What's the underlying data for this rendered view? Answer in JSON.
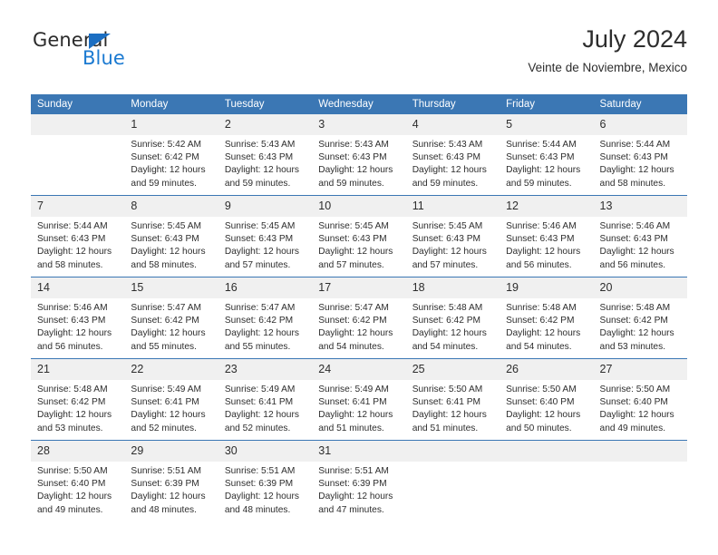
{
  "logo": {
    "word_one": "General",
    "word_two": "Blue",
    "triangle_icon": "triangle-icon"
  },
  "header": {
    "title": "July 2024",
    "subtitle": "Veinte de Noviembre, Mexico"
  },
  "colors": {
    "header_blue": "#3b77b4",
    "logo_blue": "#1b7ad1",
    "daynum_band": "#f0f0f0",
    "text": "#2d2d2d"
  },
  "weekdays": [
    "Sunday",
    "Monday",
    "Tuesday",
    "Wednesday",
    "Thursday",
    "Friday",
    "Saturday"
  ],
  "labels": {
    "sunrise_prefix": "Sunrise:",
    "sunset_prefix": "Sunset:",
    "daylight_prefix": "Daylight:"
  },
  "weeks": [
    [
      {
        "day": "",
        "sunrise": "",
        "sunset": "",
        "daylight_line1": "",
        "daylight_line2": ""
      },
      {
        "day": "1",
        "sunrise": "Sunrise: 5:42 AM",
        "sunset": "Sunset: 6:42 PM",
        "daylight_line1": "Daylight: 12 hours",
        "daylight_line2": "and 59 minutes."
      },
      {
        "day": "2",
        "sunrise": "Sunrise: 5:43 AM",
        "sunset": "Sunset: 6:43 PM",
        "daylight_line1": "Daylight: 12 hours",
        "daylight_line2": "and 59 minutes."
      },
      {
        "day": "3",
        "sunrise": "Sunrise: 5:43 AM",
        "sunset": "Sunset: 6:43 PM",
        "daylight_line1": "Daylight: 12 hours",
        "daylight_line2": "and 59 minutes."
      },
      {
        "day": "4",
        "sunrise": "Sunrise: 5:43 AM",
        "sunset": "Sunset: 6:43 PM",
        "daylight_line1": "Daylight: 12 hours",
        "daylight_line2": "and 59 minutes."
      },
      {
        "day": "5",
        "sunrise": "Sunrise: 5:44 AM",
        "sunset": "Sunset: 6:43 PM",
        "daylight_line1": "Daylight: 12 hours",
        "daylight_line2": "and 59 minutes."
      },
      {
        "day": "6",
        "sunrise": "Sunrise: 5:44 AM",
        "sunset": "Sunset: 6:43 PM",
        "daylight_line1": "Daylight: 12 hours",
        "daylight_line2": "and 58 minutes."
      }
    ],
    [
      {
        "day": "7",
        "sunrise": "Sunrise: 5:44 AM",
        "sunset": "Sunset: 6:43 PM",
        "daylight_line1": "Daylight: 12 hours",
        "daylight_line2": "and 58 minutes."
      },
      {
        "day": "8",
        "sunrise": "Sunrise: 5:45 AM",
        "sunset": "Sunset: 6:43 PM",
        "daylight_line1": "Daylight: 12 hours",
        "daylight_line2": "and 58 minutes."
      },
      {
        "day": "9",
        "sunrise": "Sunrise: 5:45 AM",
        "sunset": "Sunset: 6:43 PM",
        "daylight_line1": "Daylight: 12 hours",
        "daylight_line2": "and 57 minutes."
      },
      {
        "day": "10",
        "sunrise": "Sunrise: 5:45 AM",
        "sunset": "Sunset: 6:43 PM",
        "daylight_line1": "Daylight: 12 hours",
        "daylight_line2": "and 57 minutes."
      },
      {
        "day": "11",
        "sunrise": "Sunrise: 5:45 AM",
        "sunset": "Sunset: 6:43 PM",
        "daylight_line1": "Daylight: 12 hours",
        "daylight_line2": "and 57 minutes."
      },
      {
        "day": "12",
        "sunrise": "Sunrise: 5:46 AM",
        "sunset": "Sunset: 6:43 PM",
        "daylight_line1": "Daylight: 12 hours",
        "daylight_line2": "and 56 minutes."
      },
      {
        "day": "13",
        "sunrise": "Sunrise: 5:46 AM",
        "sunset": "Sunset: 6:43 PM",
        "daylight_line1": "Daylight: 12 hours",
        "daylight_line2": "and 56 minutes."
      }
    ],
    [
      {
        "day": "14",
        "sunrise": "Sunrise: 5:46 AM",
        "sunset": "Sunset: 6:43 PM",
        "daylight_line1": "Daylight: 12 hours",
        "daylight_line2": "and 56 minutes."
      },
      {
        "day": "15",
        "sunrise": "Sunrise: 5:47 AM",
        "sunset": "Sunset: 6:42 PM",
        "daylight_line1": "Daylight: 12 hours",
        "daylight_line2": "and 55 minutes."
      },
      {
        "day": "16",
        "sunrise": "Sunrise: 5:47 AM",
        "sunset": "Sunset: 6:42 PM",
        "daylight_line1": "Daylight: 12 hours",
        "daylight_line2": "and 55 minutes."
      },
      {
        "day": "17",
        "sunrise": "Sunrise: 5:47 AM",
        "sunset": "Sunset: 6:42 PM",
        "daylight_line1": "Daylight: 12 hours",
        "daylight_line2": "and 54 minutes."
      },
      {
        "day": "18",
        "sunrise": "Sunrise: 5:48 AM",
        "sunset": "Sunset: 6:42 PM",
        "daylight_line1": "Daylight: 12 hours",
        "daylight_line2": "and 54 minutes."
      },
      {
        "day": "19",
        "sunrise": "Sunrise: 5:48 AM",
        "sunset": "Sunset: 6:42 PM",
        "daylight_line1": "Daylight: 12 hours",
        "daylight_line2": "and 54 minutes."
      },
      {
        "day": "20",
        "sunrise": "Sunrise: 5:48 AM",
        "sunset": "Sunset: 6:42 PM",
        "daylight_line1": "Daylight: 12 hours",
        "daylight_line2": "and 53 minutes."
      }
    ],
    [
      {
        "day": "21",
        "sunrise": "Sunrise: 5:48 AM",
        "sunset": "Sunset: 6:42 PM",
        "daylight_line1": "Daylight: 12 hours",
        "daylight_line2": "and 53 minutes."
      },
      {
        "day": "22",
        "sunrise": "Sunrise: 5:49 AM",
        "sunset": "Sunset: 6:41 PM",
        "daylight_line1": "Daylight: 12 hours",
        "daylight_line2": "and 52 minutes."
      },
      {
        "day": "23",
        "sunrise": "Sunrise: 5:49 AM",
        "sunset": "Sunset: 6:41 PM",
        "daylight_line1": "Daylight: 12 hours",
        "daylight_line2": "and 52 minutes."
      },
      {
        "day": "24",
        "sunrise": "Sunrise: 5:49 AM",
        "sunset": "Sunset: 6:41 PM",
        "daylight_line1": "Daylight: 12 hours",
        "daylight_line2": "and 51 minutes."
      },
      {
        "day": "25",
        "sunrise": "Sunrise: 5:50 AM",
        "sunset": "Sunset: 6:41 PM",
        "daylight_line1": "Daylight: 12 hours",
        "daylight_line2": "and 51 minutes."
      },
      {
        "day": "26",
        "sunrise": "Sunrise: 5:50 AM",
        "sunset": "Sunset: 6:40 PM",
        "daylight_line1": "Daylight: 12 hours",
        "daylight_line2": "and 50 minutes."
      },
      {
        "day": "27",
        "sunrise": "Sunrise: 5:50 AM",
        "sunset": "Sunset: 6:40 PM",
        "daylight_line1": "Daylight: 12 hours",
        "daylight_line2": "and 49 minutes."
      }
    ],
    [
      {
        "day": "28",
        "sunrise": "Sunrise: 5:50 AM",
        "sunset": "Sunset: 6:40 PM",
        "daylight_line1": "Daylight: 12 hours",
        "daylight_line2": "and 49 minutes."
      },
      {
        "day": "29",
        "sunrise": "Sunrise: 5:51 AM",
        "sunset": "Sunset: 6:39 PM",
        "daylight_line1": "Daylight: 12 hours",
        "daylight_line2": "and 48 minutes."
      },
      {
        "day": "30",
        "sunrise": "Sunrise: 5:51 AM",
        "sunset": "Sunset: 6:39 PM",
        "daylight_line1": "Daylight: 12 hours",
        "daylight_line2": "and 48 minutes."
      },
      {
        "day": "31",
        "sunrise": "Sunrise: 5:51 AM",
        "sunset": "Sunset: 6:39 PM",
        "daylight_line1": "Daylight: 12 hours",
        "daylight_line2": "and 47 minutes."
      },
      {
        "day": "",
        "sunrise": "",
        "sunset": "",
        "daylight_line1": "",
        "daylight_line2": ""
      },
      {
        "day": "",
        "sunrise": "",
        "sunset": "",
        "daylight_line1": "",
        "daylight_line2": ""
      },
      {
        "day": "",
        "sunrise": "",
        "sunset": "",
        "daylight_line1": "",
        "daylight_line2": ""
      }
    ]
  ]
}
